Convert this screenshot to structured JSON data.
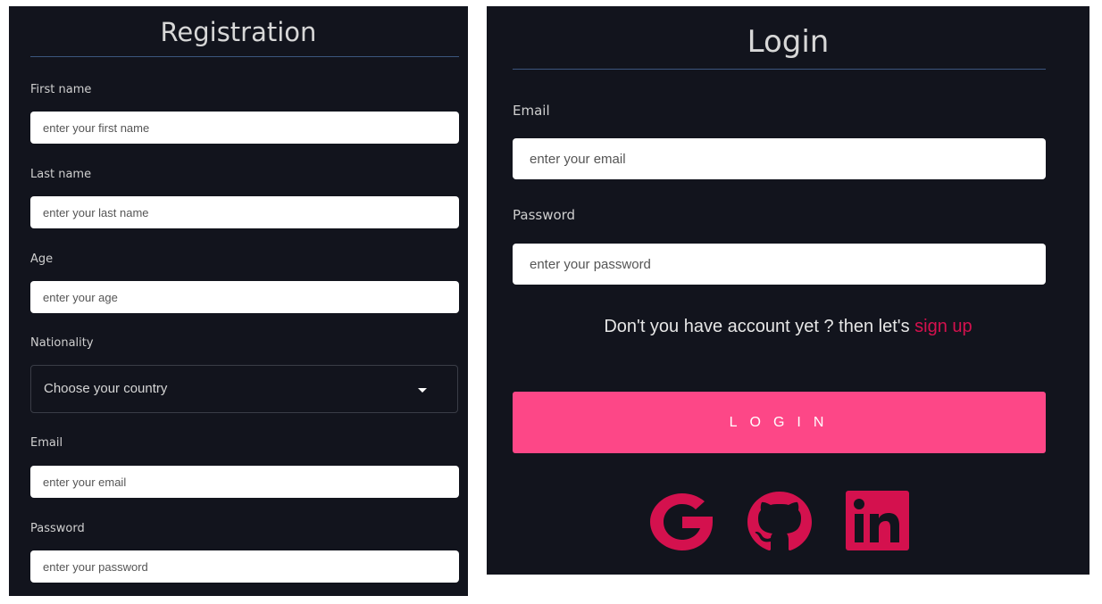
{
  "registration": {
    "title": "Registration",
    "fields": [
      {
        "label": "First name",
        "placeholder": "enter your first name"
      },
      {
        "label": "Last name",
        "placeholder": "enter your last name"
      },
      {
        "label": "Age",
        "placeholder": "enter your age"
      },
      {
        "label": "Email",
        "placeholder": "enter your email"
      },
      {
        "label": "Password",
        "placeholder": "enter your password"
      }
    ],
    "nationality": {
      "label": "Nationality",
      "selected": "Choose your country"
    }
  },
  "login": {
    "title": "Login",
    "email": {
      "label": "Email",
      "placeholder": "enter your email"
    },
    "password": {
      "label": "Password",
      "placeholder": "enter your password"
    },
    "signup_prompt": "Don't you have account yet ? then let's",
    "signup_link": "sign up",
    "button_label": "LOGIN",
    "social": [
      {
        "icon": "google-icon"
      },
      {
        "icon": "github-icon"
      },
      {
        "icon": "linkedin-icon"
      }
    ]
  },
  "colors": {
    "panel_bg": "#12141d",
    "accent": "#fd4787",
    "link": "#d4114e",
    "divider": "#3c567e"
  }
}
